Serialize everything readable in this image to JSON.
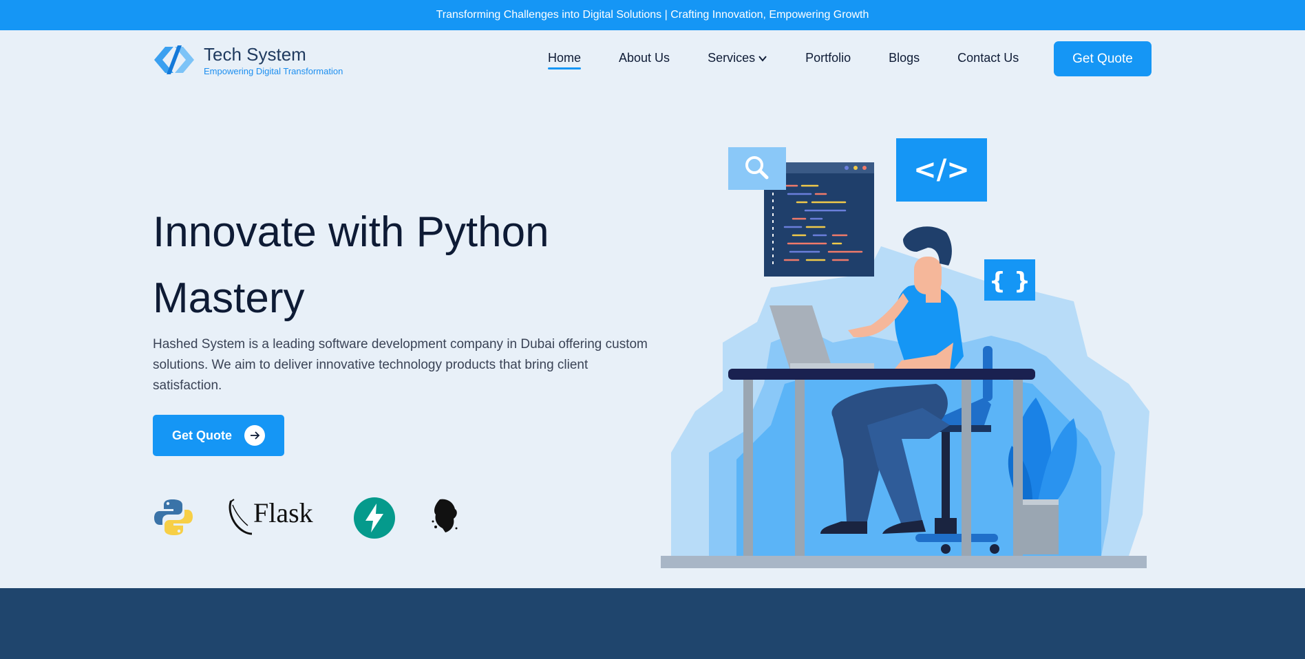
{
  "topbar": {
    "announcement": "Transforming Challenges into Digital Solutions | Crafting Innovation, Empowering Growth"
  },
  "header": {
    "logo": {
      "title": "Tech System",
      "subtitle": "Empowering Digital Transformation",
      "icon": "code-bracket-logo-icon"
    },
    "nav": [
      {
        "label": "Home",
        "active": true
      },
      {
        "label": "About Us",
        "active": false
      },
      {
        "label": "Services",
        "active": false,
        "icon": "chevron-down-icon"
      },
      {
        "label": "Portfolio",
        "active": false
      },
      {
        "label": "Blogs",
        "active": false
      },
      {
        "label": "Contact Us",
        "active": false
      }
    ],
    "cta_label": "Get Quote"
  },
  "hero": {
    "title": "Innovate with Python Mastery",
    "description": "Hashed System is a leading software development company in Dubai offering custom solutions. We aim to deliver innovative technology products that bring client satisfaction.",
    "cta_label": "Get Quote",
    "cta_icon": "arrow-right-icon",
    "tech_logos": [
      {
        "name": "python-logo-icon"
      },
      {
        "name": "flask-logo-icon",
        "text": "Flask"
      },
      {
        "name": "fastapi-logo-icon"
      },
      {
        "name": "pyramid-logo-icon"
      }
    ],
    "illustration_tags": {
      "code_tag": "</>",
      "braces_tag": "{ }"
    }
  },
  "colors": {
    "accent": "#1596f5",
    "dark_text": "#0e1b35",
    "background": "#e8f0f8",
    "footer": "#1f456d"
  }
}
